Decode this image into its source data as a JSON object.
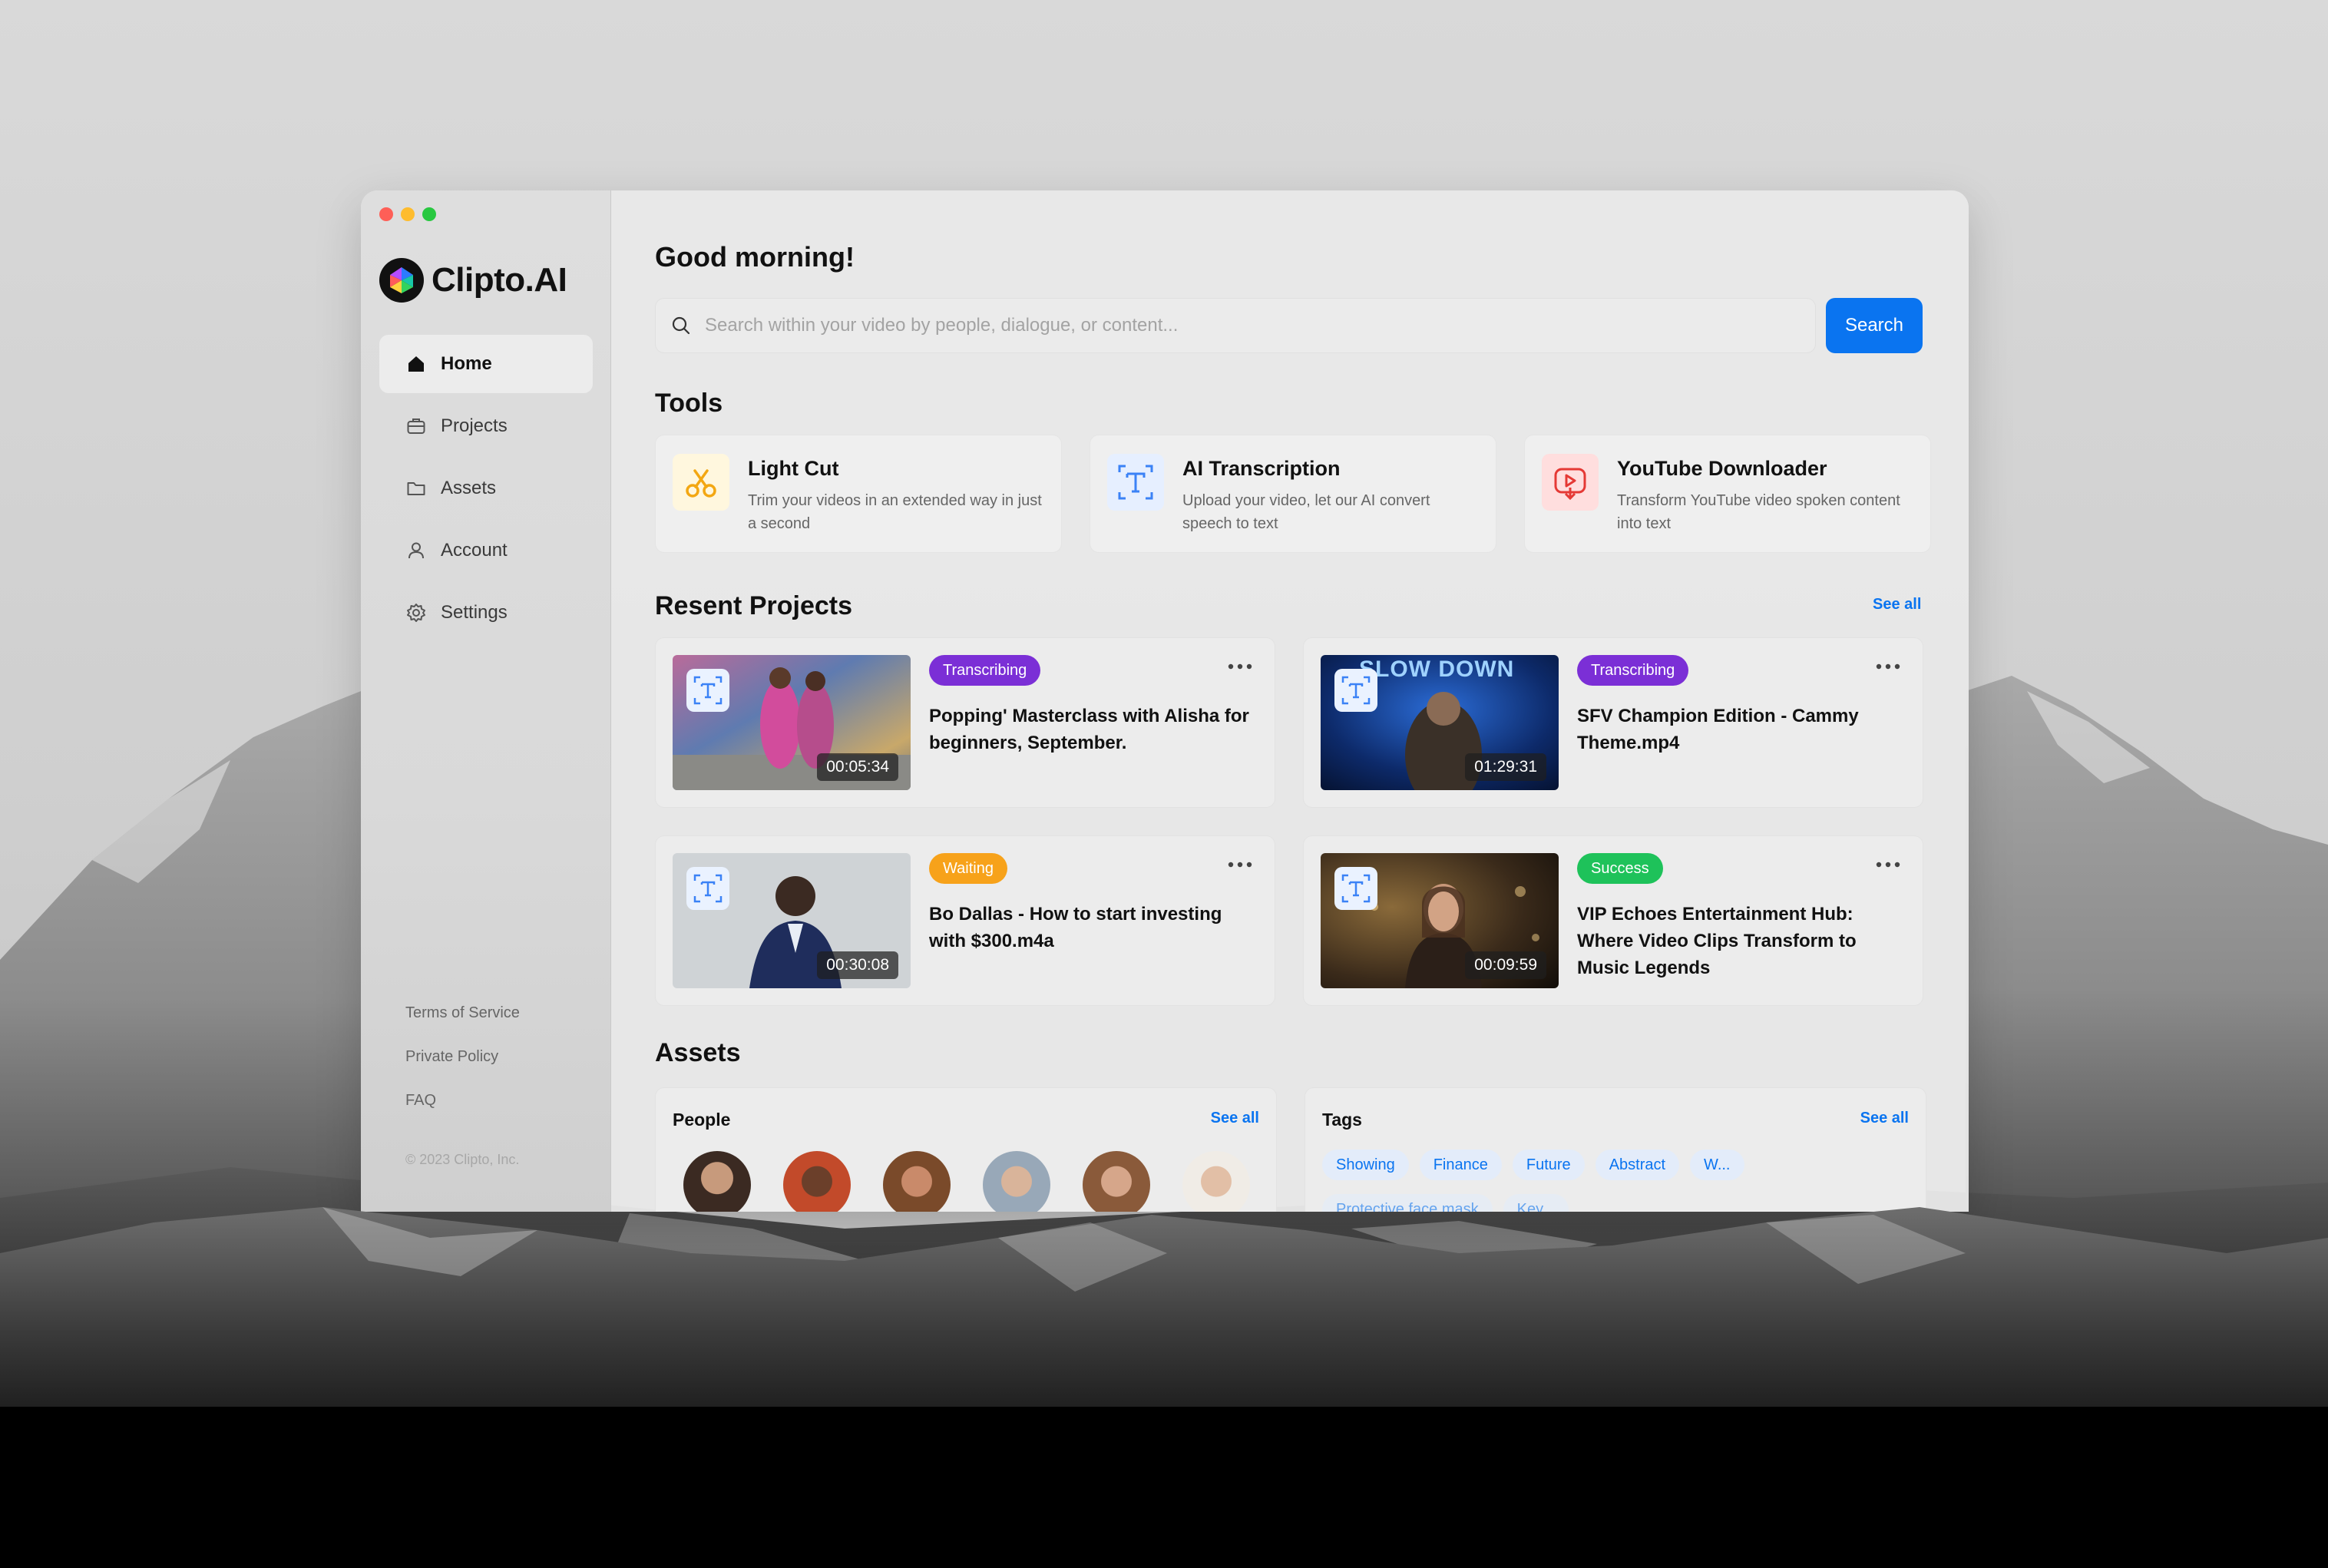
{
  "app": {
    "name": "Clipto.AI"
  },
  "nav": {
    "items": [
      {
        "label": "Home",
        "icon": "home-icon"
      },
      {
        "label": "Projects",
        "icon": "briefcase-icon"
      },
      {
        "label": "Assets",
        "icon": "folder-icon"
      },
      {
        "label": "Account",
        "icon": "user-icon"
      },
      {
        "label": "Settings",
        "icon": "gear-icon"
      }
    ],
    "active": "Home"
  },
  "footer": {
    "links": [
      "Terms of Service",
      "Private Policy",
      "FAQ"
    ],
    "copyright": "© 2023 Clipto, Inc."
  },
  "main": {
    "greeting": "Good morning!",
    "search": {
      "placeholder": "Search within your video by people, dialogue, or content...",
      "button_label": "Search"
    }
  },
  "tools": {
    "title": "Tools",
    "items": [
      {
        "title": "Light Cut",
        "desc": "Trim your videos in an extended way in just a second",
        "icon": "scissors-icon"
      },
      {
        "title": "AI Transcription",
        "desc": "Upload your video, let our AI convert speech to text",
        "icon": "text-icon"
      },
      {
        "title": "YouTube Downloader",
        "desc": "Transform YouTube video spoken content into text",
        "icon": "download-icon"
      }
    ]
  },
  "projects": {
    "title": "Resent Projects",
    "see_all": "See all",
    "items": [
      {
        "status": "Transcribing",
        "title": "Popping' Masterclass with Alisha for beginners, September.",
        "duration": "00:05:34"
      },
      {
        "status": "Transcribing",
        "title": "SFV Champion Edition - Cammy Theme.mp4",
        "duration": "01:29:31",
        "thumb_text": "SLOW DOWN"
      },
      {
        "status": "Waiting",
        "title": "Bo Dallas - How to start investing with $300.m4a",
        "duration": "00:30:08"
      },
      {
        "status": "Success",
        "title": "VIP Echoes Entertainment Hub: Where Video Clips Transform to Music Legends",
        "duration": "00:09:59"
      }
    ]
  },
  "assets": {
    "title": "Assets",
    "people": {
      "title": "People",
      "see_all": "See all"
    },
    "tags": {
      "title": "Tags",
      "see_all": "See all",
      "items": [
        "Showing",
        "Finance",
        "Future",
        "Abstract",
        "W..."
      ],
      "items_row2": [
        "Protective face mask",
        "Key..."
      ]
    }
  },
  "colors": {
    "accent": "#0a74f0",
    "transcribing": "#7b2fd6",
    "waiting": "#f7a21a",
    "success": "#1ec25a"
  }
}
